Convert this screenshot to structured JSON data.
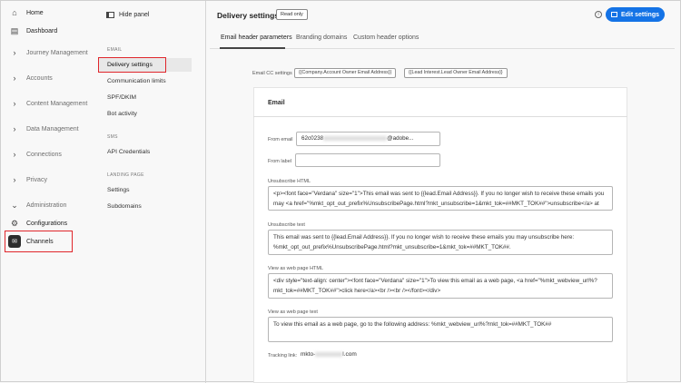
{
  "nav": {
    "items": [
      {
        "label": "Home",
        "icon": "home-icon"
      },
      {
        "label": "Dashboard",
        "icon": "dashboard-icon"
      },
      {
        "label": "Journey Management",
        "icon": "chevron-right-icon"
      },
      {
        "label": "Accounts",
        "icon": "chevron-right-icon"
      },
      {
        "label": "Content Management",
        "icon": "chevron-right-icon"
      },
      {
        "label": "Data Management",
        "icon": "chevron-right-icon"
      },
      {
        "label": "Connections",
        "icon": "chevron-right-icon"
      },
      {
        "label": "Privacy",
        "icon": "chevron-right-icon"
      },
      {
        "label": "Administration",
        "icon": "chevron-down-icon"
      },
      {
        "label": "Configurations",
        "icon": "gear-icon"
      },
      {
        "label": "Channels",
        "icon": "channels-icon"
      }
    ]
  },
  "subpanel": {
    "hide_label": "Hide panel",
    "email_head": "EMAIL",
    "email_items": [
      "Delivery settings",
      "Communication limits",
      "SPF/DKIM",
      "Bot activity"
    ],
    "sms_head": "SMS",
    "sms_items": [
      "API Credentials"
    ],
    "landing_head": "LANDING PAGE",
    "landing_items": [
      "Settings",
      "Subdomains"
    ]
  },
  "header": {
    "title": "Delivery settings",
    "badge": "Read only",
    "edit_label": "Edit settings",
    "accent": "#1473e6"
  },
  "tabs": [
    "Email header parameters",
    "Branding domains",
    "Custom header options"
  ],
  "cc": {
    "label": "Email CC settings",
    "chips": [
      "{{Company.Account Owner Email Address}}",
      "{{Lead Interest.Lead Owner Email Address}}"
    ]
  },
  "card": {
    "title": "Email",
    "from_email_label": "From email",
    "from_email_prefix": "62c0238",
    "from_email_suffix": "@adobe...",
    "from_label_label": "From label",
    "from_label_value": "",
    "unsub_html_label": "Unsubscribe HTML",
    "unsub_html": "<p><font face=\"Verdana\" size=\"1\">This email was sent to {{lead.Email Address}}. If you no longer wish to receive these emails you may <a href=\"%mkt_opt_out_prefix%UnsubscribePage.html?mkt_unsubscribe=1&mkt_tok=##MKT_TOK##\">unsubscribe</a> at anytime.</font></p>",
    "unsub_text_label": "Unsubscribe text",
    "unsub_text": "This email was sent to {{lead.Email Address}}. If you no longer wish to receive these emails you may unsubscribe here: %mkt_opt_out_prefix%UnsubscribePage.html?mkt_unsubscribe=1&mkt_tok=##MKT_TOK##.",
    "web_html_label": "View as web page HTML",
    "web_html": "<div style=\"text-align: center\"><font face=\"Verdana\" size=\"1\">To view this email as a web page, <a href=\"%mkt_webview_url%?mkt_tok=##MKT_TOK##\">click here</a><br /><br /></font></div>",
    "web_text_label": "View as web page text",
    "web_text": "To view this email as a web page, go to the following address: %mkt_webview_url%?mkt_tok=##MKT_TOK##",
    "tracking_label": "Tracking link:",
    "tracking_prefix": "mkto-",
    "tracking_suffix": "l.com"
  }
}
